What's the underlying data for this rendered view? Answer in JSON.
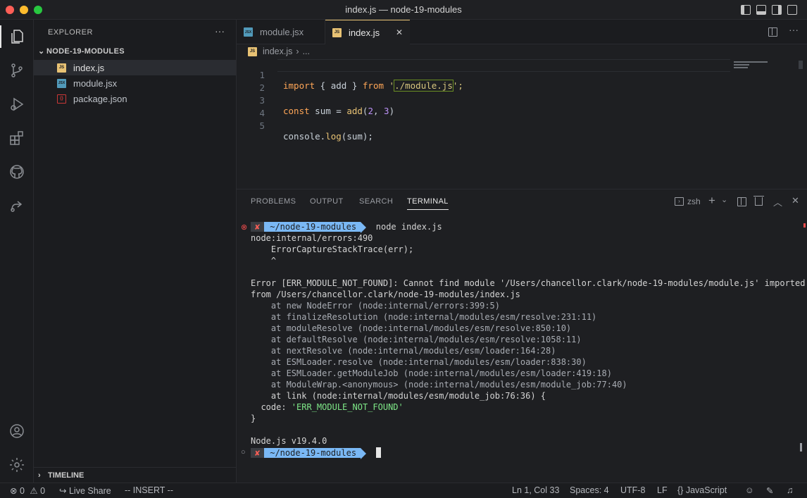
{
  "window": {
    "title": "index.js — node-19-modules",
    "traffic_lights": {
      "close": "#ff5f57",
      "minimize": "#febc2e",
      "zoom": "#28c840"
    }
  },
  "activity_bar": {
    "top": [
      "files-icon",
      "source-control-icon",
      "run-debug-icon",
      "extensions-icon",
      "github-icon",
      "live-share-icon"
    ],
    "bottom": [
      "account-icon",
      "settings-gear-icon"
    ]
  },
  "sidebar": {
    "title": "EXPLORER",
    "more": "···",
    "folder": "NODE-19-MODULES",
    "files": [
      {
        "name": "index.js",
        "icon": "JS",
        "icon_color": "#e8c274",
        "active": true
      },
      {
        "name": "module.jsx",
        "icon": "JSX",
        "icon_color": "#519aba",
        "active": false
      },
      {
        "name": "package.json",
        "icon": "{}",
        "icon_color": "#cb3837",
        "active": false
      }
    ],
    "timeline": "TIMELINE"
  },
  "tabs": [
    {
      "label": "module.jsx",
      "icon": "JSX",
      "active": false
    },
    {
      "label": "index.js",
      "icon": "JS",
      "active": true,
      "close": "✕"
    }
  ],
  "breadcrumb": {
    "file": "index.js",
    "sep": "›",
    "rest": "..."
  },
  "editor": {
    "line_numbers": [
      "1",
      "2",
      "3",
      "4",
      "5"
    ],
    "line1": {
      "kw": "import",
      "mid": " { add } ",
      "from": "from",
      "q1": " '",
      "path": "./module.js",
      "q2": "';"
    },
    "line3": {
      "kw": "const",
      "mid": " sum = ",
      "fn": "add",
      "open": "(",
      "a": "2",
      "comma": ", ",
      "b": "3",
      "close": ")"
    },
    "line5": {
      "obj": "console.",
      "fn": "log",
      "rest": "(sum);"
    }
  },
  "panel": {
    "tabs": [
      "PROBLEMS",
      "OUTPUT",
      "SEARCH",
      "TERMINAL"
    ],
    "active_tab": "TERMINAL",
    "shell": "zsh",
    "prompt_x": "✘",
    "prompt_dir": "~/node-19-modules",
    "command": "node index.js",
    "output": [
      "node:internal/errors:490",
      "    ErrorCaptureStackTrace(err);",
      "    ^",
      "",
      "Error [ERR_MODULE_NOT_FOUND]: Cannot find module '/Users/chancellor.clark/node-19-modules/module.js' imported",
      "from /Users/chancellor.clark/node-19-modules/index.js"
    ],
    "stack": [
      "    at new NodeError (node:internal/errors:399:5)",
      "    at finalizeResolution (node:internal/modules/esm/resolve:231:11)",
      "    at moduleResolve (node:internal/modules/esm/resolve:850:10)",
      "    at defaultResolve (node:internal/modules/esm/resolve:1058:11)",
      "    at nextResolve (node:internal/modules/esm/loader:164:28)",
      "    at ESMLoader.resolve (node:internal/modules/esm/loader:838:30)",
      "    at ESMLoader.getModuleJob (node:internal/modules/esm/loader:419:18)",
      "    at ModuleWrap.<anonymous> (node:internal/modules/esm/module_job:77:40)",
      "    at link (node:internal/modules/esm/module_job:76:36) {"
    ],
    "code_key": "  code: ",
    "code_val": "'ERR_MODULE_NOT_FOUND'",
    "close_brace": "}",
    "version": "Node.js v19.4.0"
  },
  "status": {
    "errors": "0",
    "warnings": "0",
    "live_share": "Live Share",
    "mode": "-- INSERT --",
    "position": "Ln 1, Col 33",
    "spaces": "Spaces: 4",
    "encoding": "UTF-8",
    "eol": "LF",
    "language": "JavaScript"
  }
}
